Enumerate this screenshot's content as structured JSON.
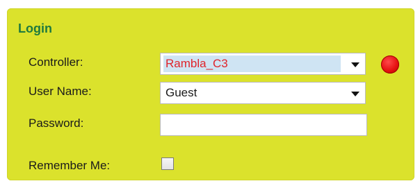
{
  "login": {
    "title": "Login",
    "controller": {
      "label": "Controller:",
      "value": "Rambla_C3",
      "value_color": "#e0242b",
      "highlight_color": "#cfe4f3"
    },
    "username": {
      "label": "User Name:",
      "value": "Guest"
    },
    "password": {
      "label": "Password:",
      "value": ""
    },
    "remember": {
      "label": "Remember Me:",
      "checked": false
    },
    "status_indicator": {
      "icon": "status-dot-icon",
      "color": "#e61212"
    }
  },
  "colors": {
    "panel_background": "#dbe22c",
    "title_color": "#1f7a3e"
  },
  "icons": {
    "dropdown_arrow": "chevron-down-icon"
  }
}
